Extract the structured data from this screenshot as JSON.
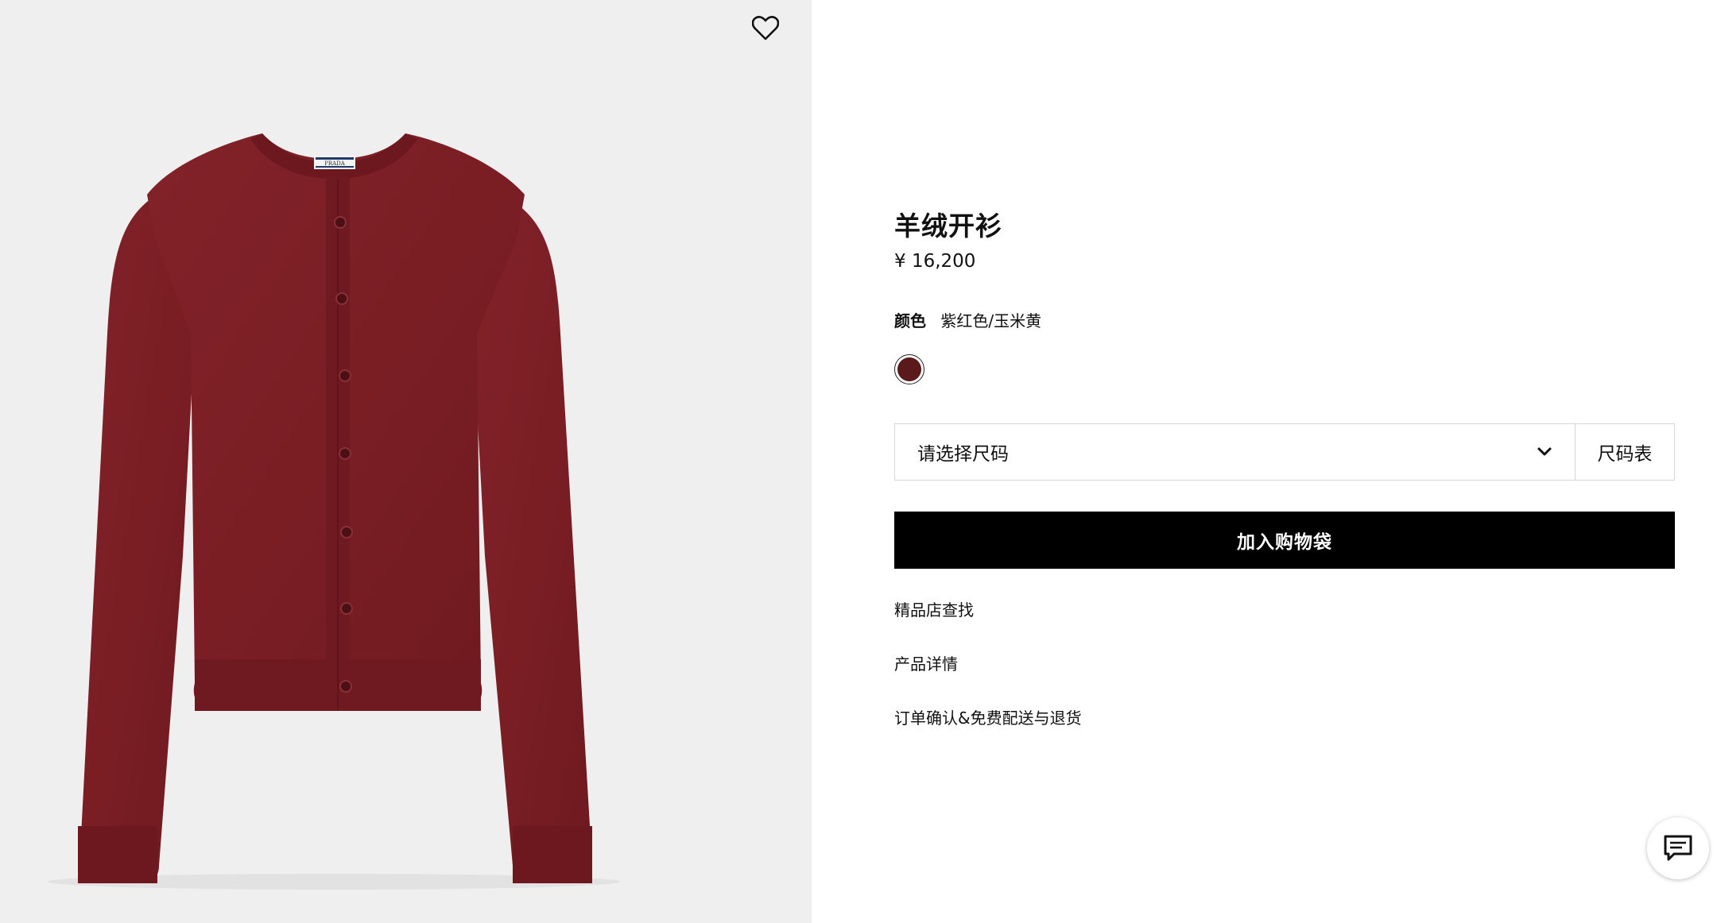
{
  "product": {
    "title": "羊绒开衫",
    "price": "¥ 16,200",
    "brand_label": "PRADA",
    "image_alt": "",
    "main_color_hex": "#7a1e22"
  },
  "color": {
    "label": "颜色",
    "value": "紫红色/玉米黄",
    "swatch_hex": "#5a1a1c"
  },
  "size": {
    "placeholder": "请选择尺码",
    "guide_label": "尺码表"
  },
  "actions": {
    "add_to_bag": "加入购物袋"
  },
  "links": [
    "精品店查找",
    "产品详情",
    "订单确认&免费配送与退货"
  ],
  "icons": {
    "wishlist": "heart-icon",
    "dropdown": "chevron-down-icon",
    "chat": "chat-icon"
  }
}
